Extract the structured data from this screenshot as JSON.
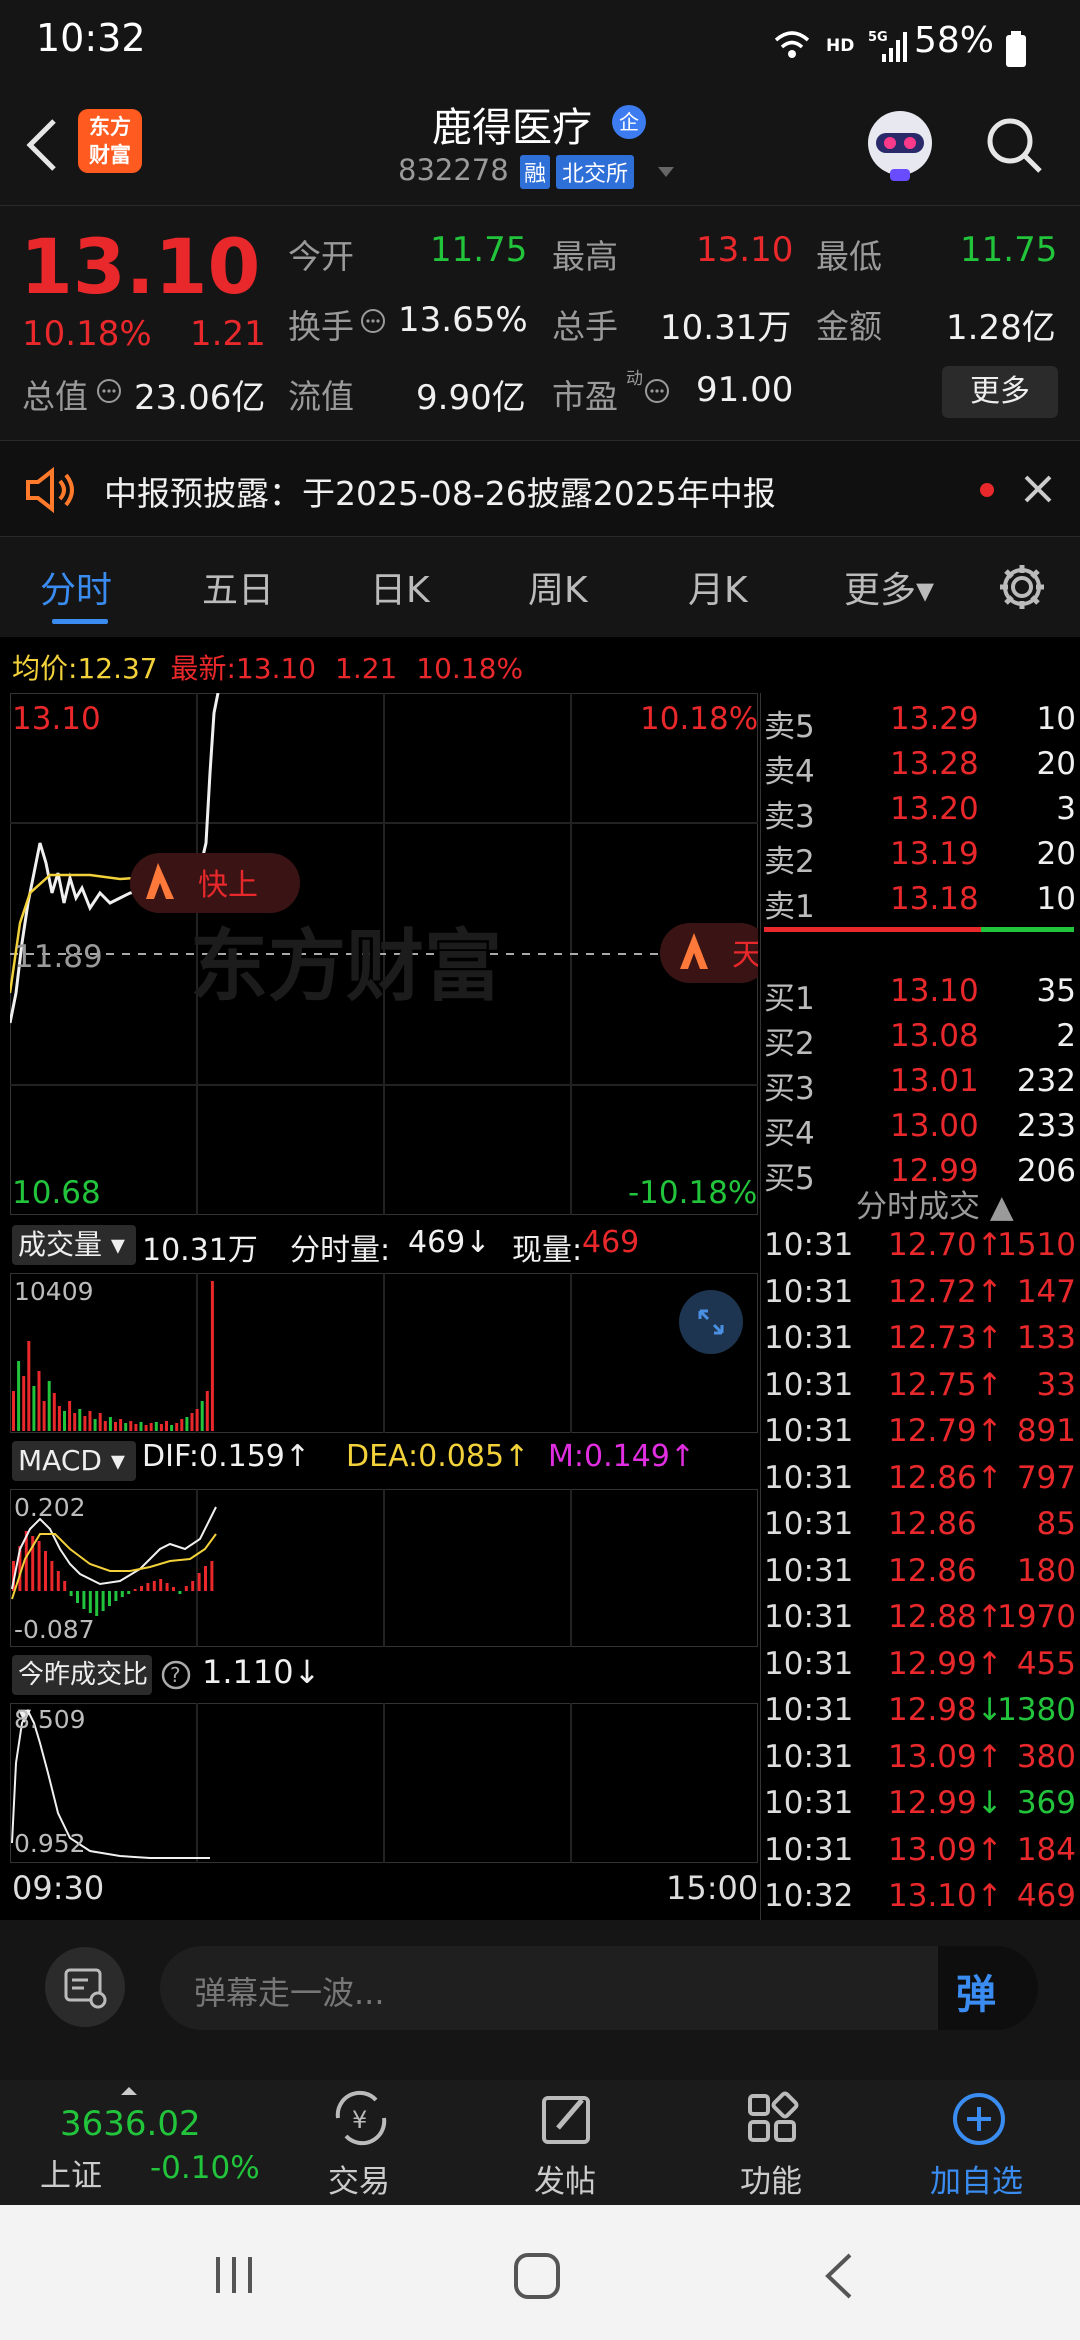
{
  "status": {
    "time": "10:32",
    "network": "HD",
    "signal": "5G",
    "battery": "58%"
  },
  "header": {
    "logo_line1": "东方",
    "logo_line2": "财富",
    "stock_name": "鹿得医疗",
    "badge": "企",
    "code": "832278",
    "tag1": "融",
    "tag2": "北交所"
  },
  "quote": {
    "price": "13.10",
    "change_pct": "10.18%",
    "change": "1.21",
    "open_label": "今开",
    "open": "11.75",
    "high_label": "最高",
    "high": "13.10",
    "low_label": "最低",
    "low": "11.75",
    "turnover_label": "换手",
    "turnover": "13.65%",
    "volume_label": "总手",
    "volume": "10.31万",
    "amount_label": "金额",
    "amount": "1.28亿",
    "mktcap_label": "总值",
    "mktcap": "23.06亿",
    "float_label": "流值",
    "float": "9.90亿",
    "pe_label": "市盈",
    "pe_sup": "动",
    "pe": "91.00",
    "more_label": "更多"
  },
  "notice": {
    "text": "中报预披露：于2025-08-26披露2025年中报"
  },
  "tabs": [
    "分时",
    "五日",
    "日K",
    "周K",
    "月K",
    "更多▾"
  ],
  "chart_header": {
    "avg_label": "均价:",
    "avg": "12.37",
    "latest_label": "最新:",
    "latest": "13.10",
    "chg": "1.21",
    "pct": "10.18%"
  },
  "price_chart": {
    "top_price": "13.10",
    "top_pct": "10.18%",
    "bottom_price": "10.68",
    "bottom_pct": "-10.18%",
    "prev_close": "11.89",
    "badge_fast": "快上",
    "badge_sky": "天",
    "watermark": "东方财富"
  },
  "volume_panel": {
    "selector": "成交量",
    "total": "10.31万",
    "period_label": "分时量:",
    "period": "469↓",
    "current_label": "现量:",
    "current": "469",
    "max": "10409"
  },
  "macd_panel": {
    "selector": "MACD",
    "dif": "DIF:0.159↑",
    "dea": "DEA:0.085↑",
    "m": "M:0.149↑",
    "max": "0.202",
    "min": "-0.087"
  },
  "ratio_panel": {
    "selector": "今昨成交比",
    "value": "1.110↓",
    "max": "8.509",
    "min": "0.952"
  },
  "time_axis": {
    "start": "09:30",
    "end": "15:00"
  },
  "order_book": {
    "asks": [
      {
        "label": "卖5",
        "price": "13.29",
        "vol": "10"
      },
      {
        "label": "卖4",
        "price": "13.28",
        "vol": "20"
      },
      {
        "label": "卖3",
        "price": "13.20",
        "vol": "3"
      },
      {
        "label": "卖2",
        "price": "13.19",
        "vol": "20"
      },
      {
        "label": "卖1",
        "price": "13.18",
        "vol": "10"
      }
    ],
    "bids": [
      {
        "label": "买1",
        "price": "13.10",
        "vol": "35"
      },
      {
        "label": "买2",
        "price": "13.08",
        "vol": "2"
      },
      {
        "label": "买3",
        "price": "13.01",
        "vol": "232"
      },
      {
        "label": "买4",
        "price": "13.00",
        "vol": "233"
      },
      {
        "label": "买5",
        "price": "12.99",
        "vol": "206"
      }
    ]
  },
  "ticks_title": "分时成交 ▲",
  "ticks": [
    {
      "t": "10:31",
      "p": "12.70↑",
      "v": "1510",
      "vc": "red"
    },
    {
      "t": "10:31",
      "p": "12.72↑",
      "v": "147",
      "vc": "red"
    },
    {
      "t": "10:31",
      "p": "12.73↑",
      "v": "133",
      "vc": "red"
    },
    {
      "t": "10:31",
      "p": "12.75↑",
      "v": "33",
      "vc": "red"
    },
    {
      "t": "10:31",
      "p": "12.79↑",
      "v": "891",
      "vc": "red"
    },
    {
      "t": "10:31",
      "p": "12.86↑",
      "v": "797",
      "vc": "red"
    },
    {
      "t": "10:31",
      "p": "12.86",
      "v": "85",
      "vc": "red"
    },
    {
      "t": "10:31",
      "p": "12.86",
      "v": "180",
      "vc": "red"
    },
    {
      "t": "10:31",
      "p": "12.88↑",
      "v": "1970",
      "vc": "red"
    },
    {
      "t": "10:31",
      "p": "12.99↑",
      "v": "455",
      "vc": "red"
    },
    {
      "t": "10:31",
      "p": "12.98↓",
      "v": "1380",
      "vc": "green"
    },
    {
      "t": "10:31",
      "p": "13.09↑",
      "v": "380",
      "vc": "red"
    },
    {
      "t": "10:31",
      "p": "12.99↓",
      "v": "369",
      "vc": "green"
    },
    {
      "t": "10:31",
      "p": "13.09↑",
      "v": "184",
      "vc": "red"
    },
    {
      "t": "10:32",
      "p": "13.10↑",
      "v": "469",
      "vc": "red"
    }
  ],
  "comment_input": {
    "placeholder": "弹幕走一波...",
    "send": "弹"
  },
  "bottom_nav": {
    "index_value": "3636.02",
    "index_name": "上证",
    "index_pct": "-0.10%",
    "trade": "交易",
    "post": "发帖",
    "function": "功能",
    "add": "加自选"
  }
}
